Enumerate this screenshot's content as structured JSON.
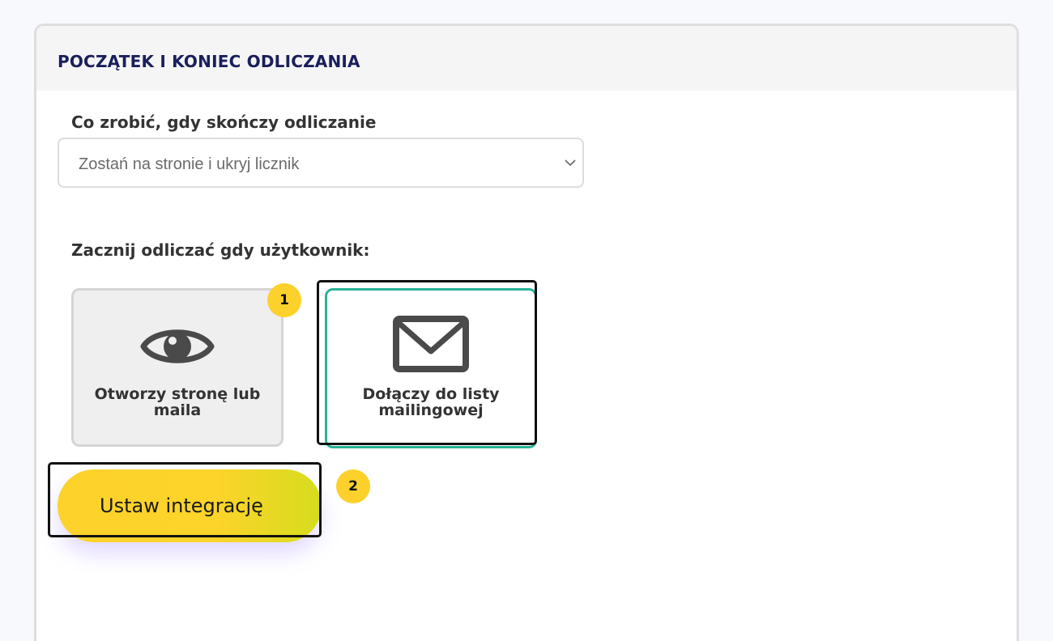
{
  "panel": {
    "title": "POCZĄTEK I KONIEC ODLICZANIA"
  },
  "end_action": {
    "label": "Co zrobić, gdy skończy odliczanie",
    "selected_value": "Zostań na stronie i ukryj licznik"
  },
  "start_trigger": {
    "label": "Zacznij odliczać gdy użytkownik:",
    "options": [
      {
        "label": "Otworzy stronę lub maila",
        "icon": "eye-icon",
        "selected": false
      },
      {
        "label": "Dołączy do listy mailingowej",
        "icon": "envelope-icon",
        "selected": true
      }
    ]
  },
  "cta": {
    "label": "Ustaw integrację"
  },
  "badges": [
    "1",
    "2"
  ],
  "colors": {
    "title": "#1a1f5c",
    "accent_yellow": "#fdd12b",
    "selected_border": "#2ab397",
    "highlight_border": "#111111"
  }
}
